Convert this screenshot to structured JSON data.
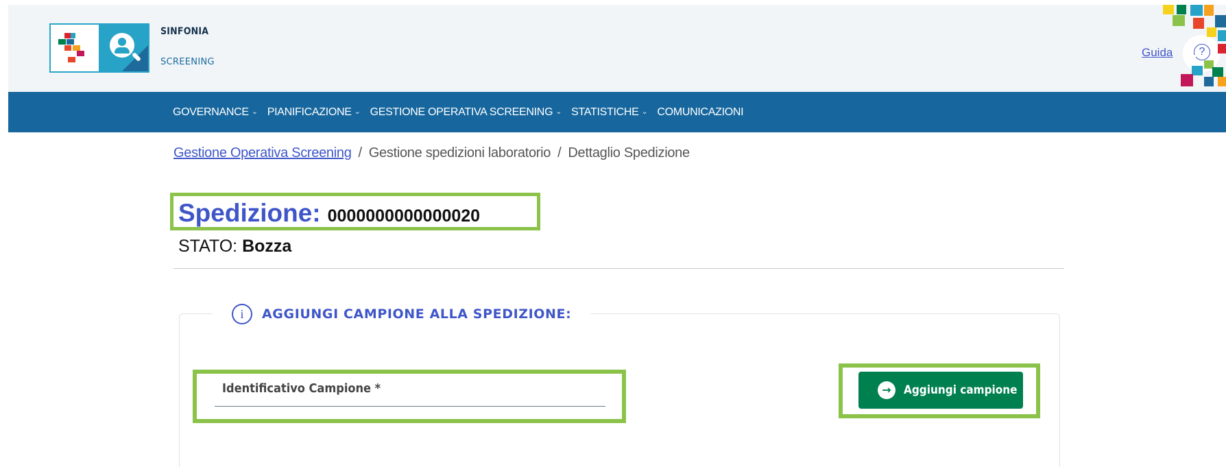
{
  "header": {
    "brand_title": "SINFONIA",
    "brand_subtitle": "SCREENING",
    "guide_link": "Guida",
    "help_icon": "question-circle-icon",
    "colors": {
      "background": "#f2f5f8",
      "logo_accent": "#26a3c6"
    }
  },
  "nav": {
    "items": [
      {
        "label": "GOVERNANCE",
        "has_dropdown": true
      },
      {
        "label": "PIANIFICAZIONE",
        "has_dropdown": true
      },
      {
        "label": "GESTIONE OPERATIVA SCREENING",
        "has_dropdown": true
      },
      {
        "label": "STATISTICHE",
        "has_dropdown": true
      },
      {
        "label": "COMUNICAZIONI",
        "has_dropdown": false
      }
    ],
    "chevron": "⌄",
    "color": "#17679e"
  },
  "breadcrumb": {
    "items": [
      "Gestione Operativa Screening",
      "Gestione spedizioni laboratorio",
      "Dettaglio Spedizione"
    ],
    "separator": "/"
  },
  "shipment": {
    "title_label": "Spedizione:",
    "id": "0000000000000020",
    "status_label": "STATO:",
    "status_value": "Bozza"
  },
  "add_sample": {
    "section_title": "AGGIUNGI CAMPIONE ALLA SPEDIZIONE:",
    "info_icon": "info-circle-icon",
    "field_label": "Identificativo Campione *",
    "field_value": "",
    "button_label": "Aggiungi campione",
    "button_icon": "arrow-right-circle-icon",
    "button_color": "#00804f"
  },
  "highlight_color": "#8bc34a"
}
